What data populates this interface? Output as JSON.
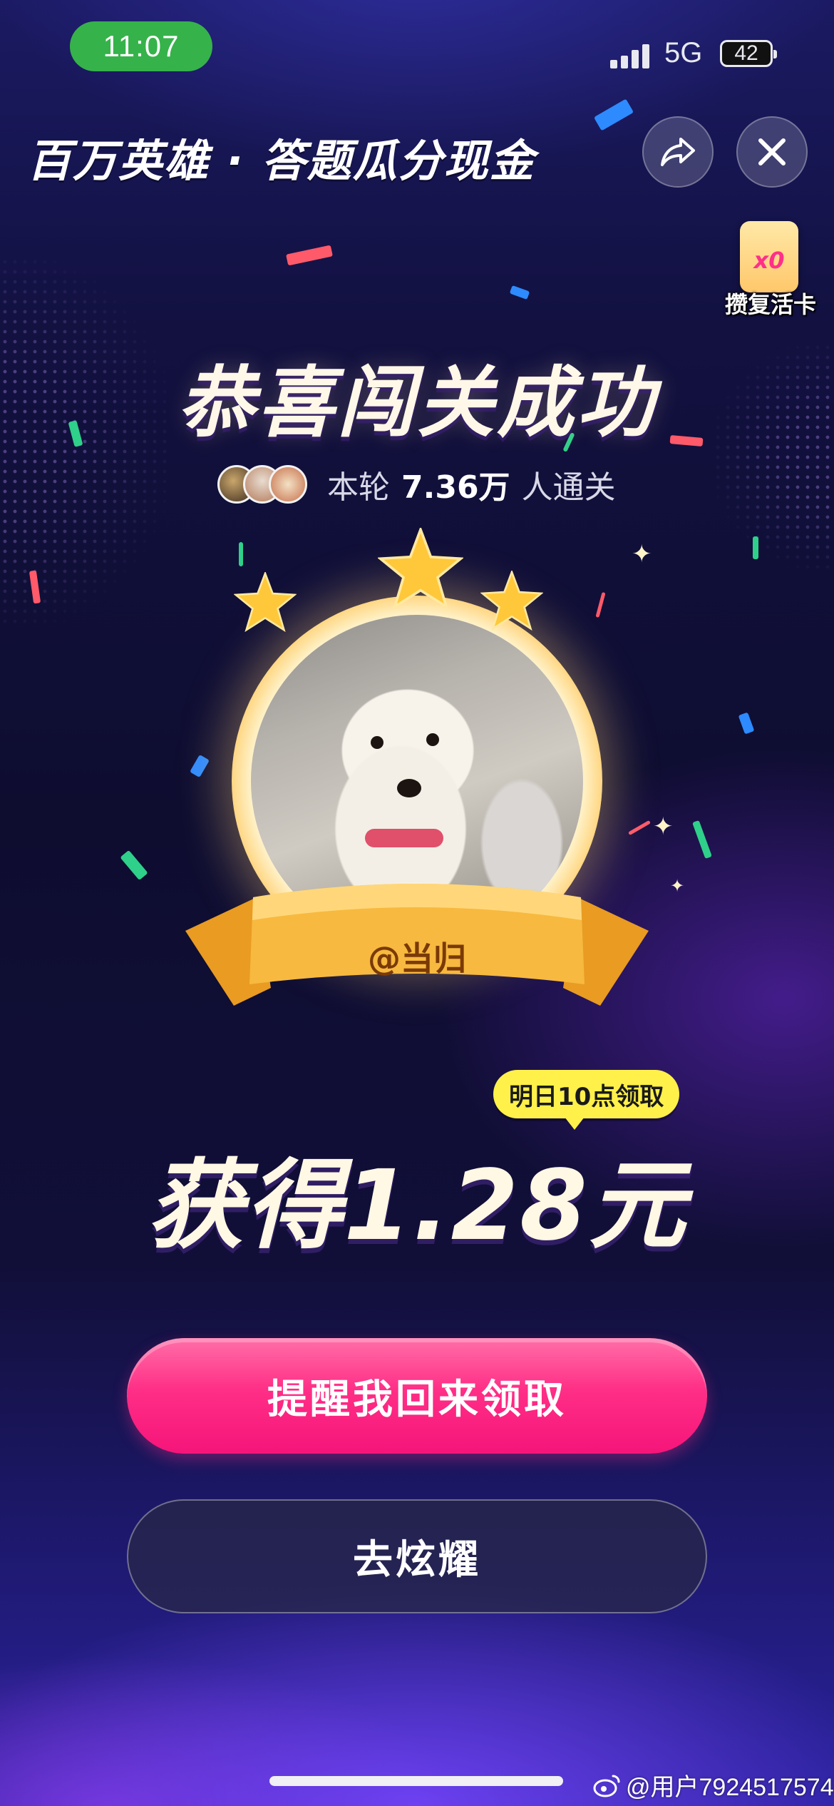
{
  "status_bar": {
    "time": "11:07",
    "network": "5G",
    "battery": "42"
  },
  "header": {
    "title": "百万英雄 · 答题瓜分现金"
  },
  "revive_card": {
    "count": "x0",
    "label": "攒复活卡"
  },
  "result": {
    "title": "恭喜闯关成功",
    "stat_prefix": "本轮",
    "stat_value": "7.36万",
    "stat_suffix": "人通关"
  },
  "badge": {
    "username": "@当归"
  },
  "reward": {
    "tip": "明日10点领取",
    "text": "获得1.28元"
  },
  "actions": {
    "remind_label": "提醒我回来领取",
    "show_off_label": "去炫耀"
  },
  "footer": {
    "weibo_user": "@用户7924517574"
  },
  "colors": {
    "primary_button": "#ff2e86",
    "tip_bg": "#fff14a",
    "status_pill": "#36b24a",
    "ribbon": "#f6b43c"
  },
  "icons": {
    "share": "share-arrow-icon",
    "close": "close-icon",
    "weibo": "weibo-icon"
  }
}
